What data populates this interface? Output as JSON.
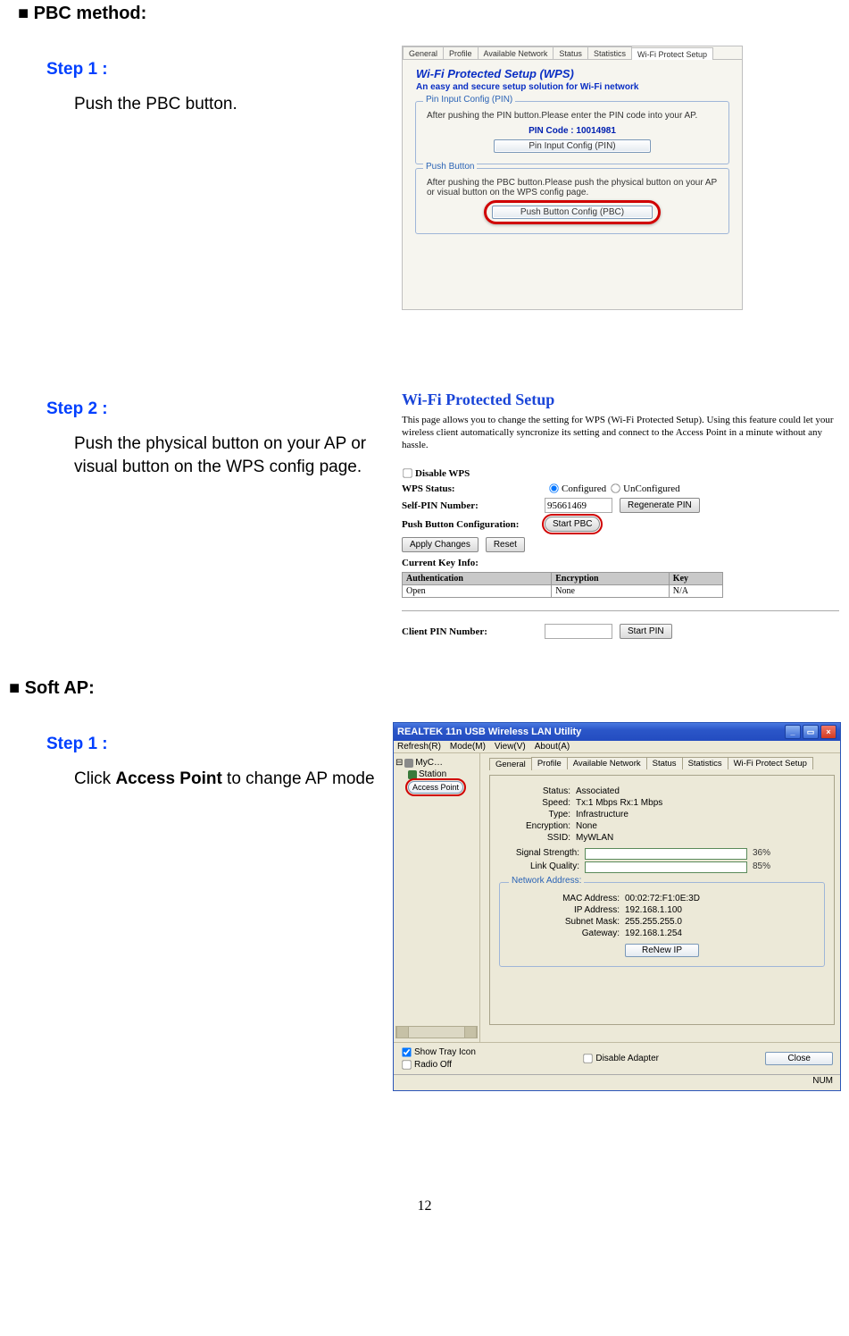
{
  "pbc_section": {
    "title": "■ PBC method:",
    "step1": {
      "label": "Step 1 :",
      "body": "Push the PBC button."
    },
    "step2": {
      "label": "Step 2 :",
      "body": "Push the physical button on your AP or visual button on the WPS config page."
    }
  },
  "softap_section": {
    "title": "■ Soft AP:",
    "step1": {
      "label": "Step 1 :",
      "body_pre": "Click ",
      "body_bold": "Access Point",
      "body_post": " to change AP mode"
    }
  },
  "dialog1": {
    "tabs": [
      "General",
      "Profile",
      "Available Network",
      "Status",
      "Statistics",
      "Wi-Fi Protect Setup"
    ],
    "active_tab": 5,
    "title": "Wi-Fi Protected Setup (WPS)",
    "subtitle": "An easy and secure setup solution for Wi-Fi network",
    "pin_group": {
      "legend": "Pin Input Config (PIN)",
      "text": "After pushing the PIN button.Please enter the PIN code into your AP.",
      "pin_label": "PIN Code :  10014981",
      "btn": "Pin Input Config (PIN)"
    },
    "pbc_group": {
      "legend": "Push Button",
      "text": "After pushing the PBC button.Please push the physical button on your AP or visual button on the WPS config page.",
      "btn": "Push Button Config (PBC)"
    }
  },
  "web_wps": {
    "title": "Wi-Fi Protected Setup",
    "desc": "This page allows you to change the setting for WPS (Wi-Fi Protected Setup). Using this feature could let your wireless client automatically syncronize its setting and connect to the Access Point in a minute without any hassle.",
    "disable_label": "Disable WPS",
    "status_label": "WPS Status:",
    "status_cfg": "Configured",
    "status_uncfg": "UnConfigured",
    "selfpin_label": "Self-PIN Number:",
    "selfpin_value": "95661469",
    "regen_btn": "Regenerate PIN",
    "pbc_label": "Push Button Configuration:",
    "pbc_btn": "Start PBC",
    "apply_btn": "Apply Changes",
    "reset_btn": "Reset",
    "cki_label": "Current Key Info:",
    "cki_headers": [
      "Authentication",
      "Encryption",
      "Key"
    ],
    "cki_row": [
      "Open",
      "None",
      "N/A"
    ],
    "clientpin_label": "Client PIN Number:",
    "startpin_btn": "Start PIN"
  },
  "util": {
    "title": "REALTEK 11n USB Wireless LAN Utility",
    "menu": [
      "Refresh(R)",
      "Mode(M)",
      "View(V)",
      "About(A)"
    ],
    "tree": {
      "root": "MyC…",
      "child": "Station",
      "popup": "Access Point"
    },
    "tabs": [
      "General",
      "Profile",
      "Available Network",
      "Status",
      "Statistics",
      "Wi-Fi Protect Setup"
    ],
    "active_tab": 0,
    "general": {
      "status_k": "Status:",
      "status_v": "Associated",
      "speed_k": "Speed:",
      "speed_v": "Tx:1 Mbps Rx:1 Mbps",
      "type_k": "Type:",
      "type_v": "Infrastructure",
      "enc_k": "Encryption:",
      "enc_v": "None",
      "ssid_k": "SSID:",
      "ssid_v": "MyWLAN",
      "sig_k": "Signal Strength:",
      "sig_pct": "36%",
      "link_k": "Link Quality:",
      "link_pct": "85%"
    },
    "netaddr": {
      "legend": "Network Address:",
      "mac_k": "MAC Address:",
      "mac_v": "00:02:72:F1:0E:3D",
      "ip_k": "IP Address:",
      "ip_v": "192.168.1.100",
      "mask_k": "Subnet Mask:",
      "mask_v": "255.255.255.0",
      "gw_k": "Gateway:",
      "gw_v": "192.168.1.254",
      "renew_btn": "ReNew IP"
    },
    "bottom": {
      "tray": "Show Tray Icon",
      "radio": "Radio Off",
      "disable": "Disable Adapter",
      "close": "Close"
    },
    "statusbar": "NUM"
  },
  "page_number": "12"
}
